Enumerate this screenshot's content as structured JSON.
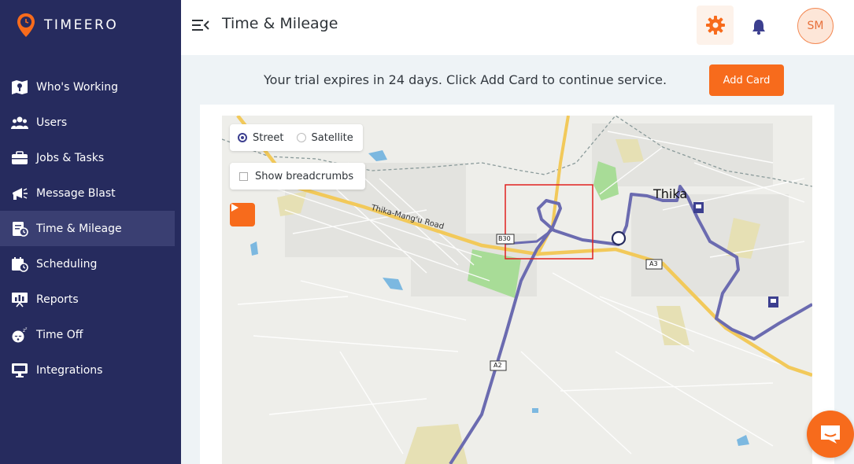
{
  "app": {
    "name": "TIMEERO"
  },
  "sidebar": {
    "items": [
      {
        "label": "Who's Working",
        "icon": "map-pin-icon"
      },
      {
        "label": "Users",
        "icon": "users-icon"
      },
      {
        "label": "Jobs & Tasks",
        "icon": "briefcase-icon"
      },
      {
        "label": "Message Blast",
        "icon": "megaphone-icon"
      },
      {
        "label": "Time & Mileage",
        "icon": "time-sheet-icon",
        "active": true
      },
      {
        "label": "Scheduling",
        "icon": "calendar-clock-icon"
      },
      {
        "label": "Reports",
        "icon": "presentation-icon"
      },
      {
        "label": "Time Off",
        "icon": "sleep-icon"
      },
      {
        "label": "Integrations",
        "icon": "monitor-icon"
      }
    ]
  },
  "header": {
    "title": "Time & Mileage",
    "avatar_initials": "SM"
  },
  "trial": {
    "message": "Your trial expires in 24 days. Click Add Card to continue service.",
    "button_label": "Add Card"
  },
  "map": {
    "map_types": [
      {
        "label": "Street",
        "selected": true
      },
      {
        "label": "Satellite",
        "selected": false
      }
    ],
    "breadcrumbs_label": "Show breadcrumbs",
    "breadcrumbs_checked": false,
    "labels": {
      "town": "Thika",
      "road": "Thika-Mang'u Road",
      "b30": "B30",
      "a3": "A3",
      "a2": "A2"
    }
  },
  "colors": {
    "sidebar": "#262b5e",
    "accent": "#f76b1c",
    "route": "#6b6bb0"
  }
}
